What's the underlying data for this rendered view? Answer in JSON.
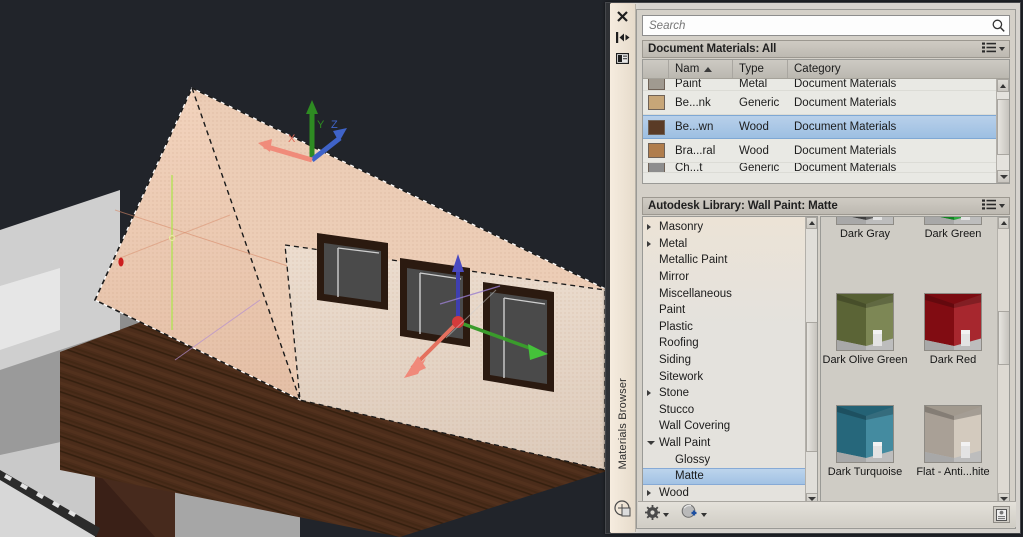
{
  "viewport": {
    "name": "3d-model-viewport",
    "background_color": "#21242a",
    "description": "3D architectural room model with selected wall highlighted",
    "gizmo": {
      "axis_x_color": "#e06a5a",
      "axis_y_color": "#4fa83c",
      "axis_z_color": "#3f63c8"
    },
    "ucs_labels": {
      "x": "X",
      "y": "Y",
      "z": "Z"
    }
  },
  "palette": {
    "name": "Materials Browser",
    "vertical_title": "Materials Browser",
    "rail_icons": [
      {
        "name": "close-icon",
        "glyph": "close"
      },
      {
        "name": "auto-hide-icon",
        "glyph": "autohide"
      },
      {
        "name": "panel-properties-icon",
        "glyph": "panel"
      }
    ],
    "search": {
      "placeholder": "Search",
      "value": "",
      "icon": "search-icon"
    },
    "document_section": {
      "title": "Document Materials: All",
      "view_icon": "list-view-icon",
      "columns": [
        "",
        "Nam",
        "Type",
        "Category"
      ],
      "sorted_column": "Nam",
      "sort_direction": "ascending",
      "rows": [
        {
          "name": "Paint",
          "type": "Metal",
          "category": "Document Materials",
          "swatch": "#a09a90",
          "selected": false,
          "clipped": "top"
        },
        {
          "name": "Be...nk",
          "type": "Generic",
          "category": "Document Materials",
          "swatch": "#c7a678",
          "selected": false
        },
        {
          "name": "Be...wn",
          "type": "Wood",
          "category": "Document Materials",
          "swatch": "#5a3b26",
          "selected": true
        },
        {
          "name": "Bra...ral",
          "type": "Wood",
          "category": "Document Materials",
          "swatch": "#b07d4c",
          "selected": false
        },
        {
          "name": "Ch...t",
          "type": "Generic",
          "category": "Document Materials",
          "swatch": "#8d8d8d",
          "selected": false,
          "clipped": "bottom"
        }
      ]
    },
    "library_section": {
      "title": "Autodesk Library: Wall Paint: Matte",
      "view_icon": "list-view-icon",
      "tree": [
        {
          "label": "Masonry",
          "expandable": true,
          "expanded": false,
          "level": 1,
          "selected": false
        },
        {
          "label": "Metal",
          "expandable": true,
          "expanded": false,
          "level": 1,
          "selected": false
        },
        {
          "label": "Metallic Paint",
          "expandable": false,
          "expanded": false,
          "level": 1,
          "selected": false
        },
        {
          "label": "Mirror",
          "expandable": false,
          "expanded": false,
          "level": 1,
          "selected": false
        },
        {
          "label": "Miscellaneous",
          "expandable": false,
          "expanded": false,
          "level": 1,
          "selected": false
        },
        {
          "label": "Paint",
          "expandable": false,
          "expanded": false,
          "level": 1,
          "selected": false
        },
        {
          "label": "Plastic",
          "expandable": false,
          "expanded": false,
          "level": 1,
          "selected": false
        },
        {
          "label": "Roofing",
          "expandable": false,
          "expanded": false,
          "level": 1,
          "selected": false
        },
        {
          "label": "Siding",
          "expandable": false,
          "expanded": false,
          "level": 1,
          "selected": false
        },
        {
          "label": "Sitework",
          "expandable": false,
          "expanded": false,
          "level": 1,
          "selected": false
        },
        {
          "label": "Stone",
          "expandable": true,
          "expanded": false,
          "level": 1,
          "selected": false
        },
        {
          "label": "Stucco",
          "expandable": false,
          "expanded": false,
          "level": 1,
          "selected": false
        },
        {
          "label": "Wall Covering",
          "expandable": false,
          "expanded": false,
          "level": 1,
          "selected": false
        },
        {
          "label": "Wall Paint",
          "expandable": true,
          "expanded": true,
          "level": 1,
          "selected": false
        },
        {
          "label": "Glossy",
          "expandable": false,
          "expanded": false,
          "level": 2,
          "selected": false
        },
        {
          "label": "Matte",
          "expandable": false,
          "expanded": false,
          "level": 2,
          "selected": true
        },
        {
          "label": "Wood",
          "expandable": true,
          "expanded": false,
          "level": 1,
          "selected": false
        }
      ],
      "thumbnails": [
        {
          "label": "Dark Gray",
          "color": "#4c4c4c",
          "clipped": true
        },
        {
          "label": "Dark Green",
          "color": "#16a02a",
          "clipped": true
        },
        {
          "label": "Dark Olive Green",
          "color": "#6f7a42",
          "clipped": false
        },
        {
          "label": "Dark Red",
          "color": "#9e0f17",
          "clipped": false
        },
        {
          "label": "Dark Turquoise",
          "color": "#2f7e96",
          "clipped": false
        },
        {
          "label": "Flat - Anti...hite",
          "color": "#cfc4b7",
          "clipped": false
        }
      ]
    },
    "footer": {
      "buttons": [
        {
          "name": "manage-settings-button",
          "icon": "gear-icon",
          "has_dropdown": true
        },
        {
          "name": "create-material-button",
          "icon": "new-material-sphere-icon",
          "has_dropdown": true
        }
      ],
      "right_button": {
        "name": "toggle-preview-button",
        "icon": "preview-panel-icon"
      }
    }
  }
}
